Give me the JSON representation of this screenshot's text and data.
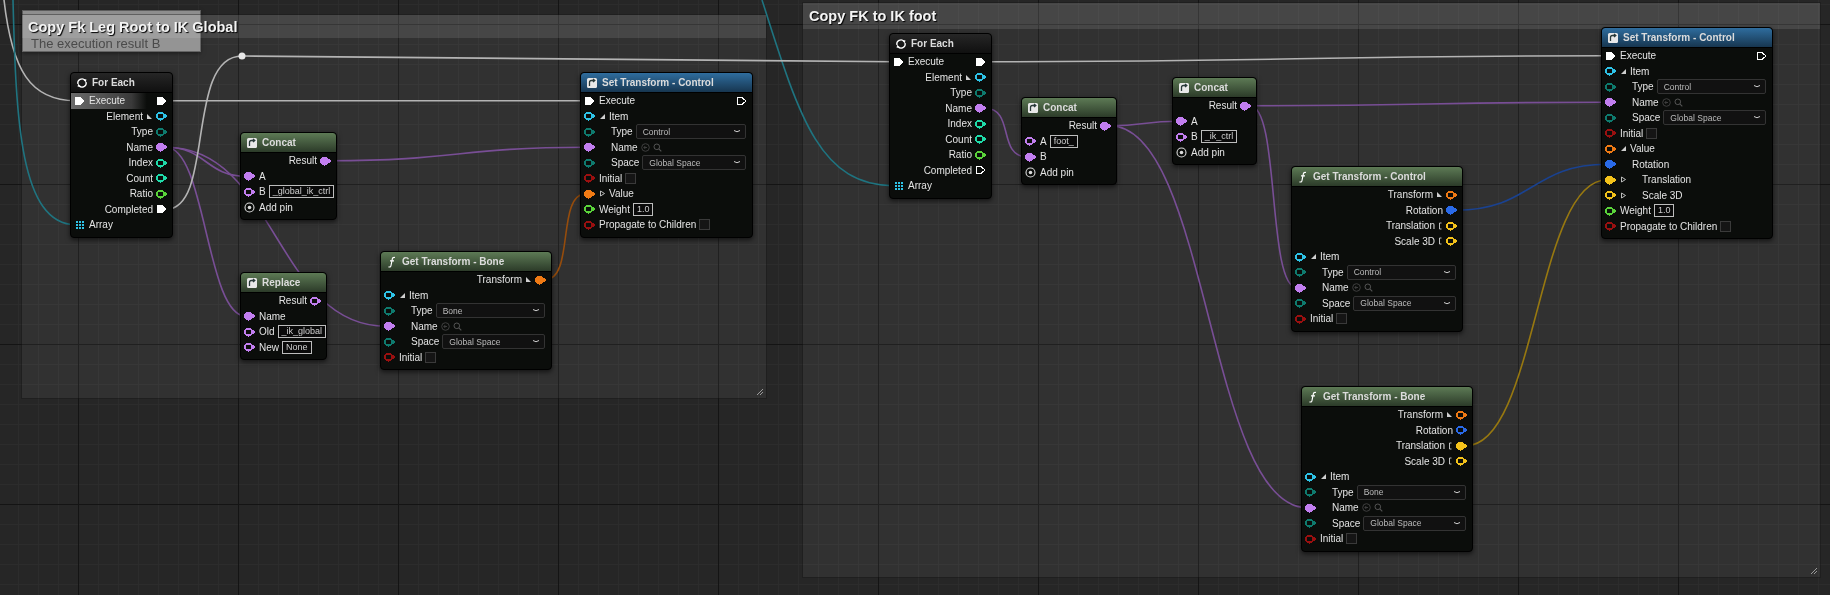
{
  "tooltip": {
    "text": "The execution result B"
  },
  "comments": [
    {
      "title": "Copy Fk Leg Root to IK Global",
      "nodes": [
        {
          "kind": "for_each",
          "title": "For Each",
          "rows": [
            {
              "label": "Execute",
              "hovered": true,
              "in": {
                "kind": "exec",
                "connected": true
              },
              "out": {
                "kind": "exec",
                "connected": true
              }
            },
            {
              "label": "Element",
              "split": true,
              "out": {
                "kind": "data",
                "color": "#2ec3e8",
                "connected": false
              }
            },
            {
              "label": "Type",
              "out": {
                "kind": "data",
                "color": "#0e7a6e",
                "connected": false
              }
            },
            {
              "label": "Name",
              "out": {
                "kind": "data",
                "color": "#c27ef0",
                "connected": true
              }
            },
            {
              "label": "Index",
              "out": {
                "kind": "data",
                "color": "#1fdcaa",
                "connected": false
              }
            },
            {
              "label": "Count",
              "out": {
                "kind": "data",
                "color": "#1fdcaa",
                "connected": false
              }
            },
            {
              "label": "Ratio",
              "out": {
                "kind": "data",
                "color": "#5ad43a",
                "connected": false
              }
            },
            {
              "label": "Completed",
              "out": {
                "kind": "exec",
                "connected": true
              }
            },
            {
              "label": "Array",
              "in": {
                "kind": "array",
                "connected": true
              }
            }
          ]
        },
        {
          "kind": "string_op",
          "title": "Concat",
          "rows": [
            {
              "label": "Result",
              "out": {
                "kind": "data",
                "color": "#c27ef0",
                "connected": true
              }
            },
            {
              "label": "A",
              "in": {
                "kind": "data",
                "color": "#c27ef0",
                "connected": true
              }
            },
            {
              "label": "B",
              "in": {
                "kind": "data",
                "color": "#c27ef0",
                "connected": false
              },
              "field": {
                "kind": "text",
                "value": "_global_ik_ctrl"
              }
            },
            {
              "label": "Add pin",
              "kind": "add_pin"
            }
          ]
        },
        {
          "kind": "string_op",
          "title": "Replace",
          "rows": [
            {
              "label": "Result",
              "out": {
                "kind": "data",
                "color": "#c27ef0",
                "connected": false
              }
            },
            {
              "label": "Name",
              "in": {
                "kind": "data",
                "color": "#c27ef0",
                "connected": true
              }
            },
            {
              "label": "Old",
              "in": {
                "kind": "data",
                "color": "#c27ef0",
                "connected": false
              },
              "field": {
                "kind": "text",
                "value": "_ik_global"
              }
            },
            {
              "label": "New",
              "in": {
                "kind": "data",
                "color": "#c27ef0",
                "connected": false
              },
              "field": {
                "kind": "text",
                "value": "None"
              }
            }
          ]
        },
        {
          "kind": "get",
          "title": "Get Transform - Bone",
          "rows": [
            {
              "label": "Transform",
              "split": true,
              "out": {
                "kind": "data",
                "color": "#f07a14",
                "connected": true
              }
            },
            {
              "label": "Item",
              "expanded": true,
              "in": {
                "kind": "data",
                "color": "#2ec3e8",
                "connected": false
              },
              "children": [
                {
                  "label": "Type",
                  "in": {
                    "kind": "data",
                    "color": "#0e7a6e",
                    "connected": false
                  },
                  "field": {
                    "kind": "dropdown",
                    "value": "Bone"
                  }
                },
                {
                  "label": "Name",
                  "in": {
                    "kind": "data",
                    "color": "#c27ef0",
                    "connected": true
                  },
                  "field": {
                    "kind": "picker"
                  }
                },
                {
                  "label": "Space",
                  "in": {
                    "kind": "data",
                    "color": "#0e7a6e",
                    "connected": false
                  },
                  "field": {
                    "kind": "dropdown",
                    "value": "Global Space"
                  }
                }
              ]
            },
            {
              "label": "Initial",
              "in": {
                "kind": "data",
                "color": "#9a1010",
                "connected": false
              },
              "field": {
                "kind": "checkbox",
                "checked": false
              }
            }
          ]
        },
        {
          "kind": "set",
          "title": "Set Transform - Control",
          "rows": [
            {
              "label": "Execute",
              "in": {
                "kind": "exec",
                "connected": true
              },
              "out": {
                "kind": "exec",
                "connected": false
              }
            },
            {
              "label": "Item",
              "expanded": true,
              "in": {
                "kind": "data",
                "color": "#2ec3e8",
                "connected": false
              },
              "children": [
                {
                  "label": "Type",
                  "in": {
                    "kind": "data",
                    "color": "#0e7a6e",
                    "connected": false
                  },
                  "field": {
                    "kind": "dropdown",
                    "value": "Control"
                  }
                },
                {
                  "label": "Name",
                  "in": {
                    "kind": "data",
                    "color": "#c27ef0",
                    "connected": true
                  },
                  "field": {
                    "kind": "picker"
                  }
                },
                {
                  "label": "Space",
                  "in": {
                    "kind": "data",
                    "color": "#0e7a6e",
                    "connected": false
                  },
                  "field": {
                    "kind": "dropdown",
                    "value": "Global Space"
                  }
                }
              ]
            },
            {
              "label": "Initial",
              "in": {
                "kind": "data",
                "color": "#9a1010",
                "connected": false
              },
              "field": {
                "kind": "checkbox",
                "checked": false
              }
            },
            {
              "label": "Value",
              "expanded": false,
              "in": {
                "kind": "data",
                "color": "#f07a14",
                "connected": true
              }
            },
            {
              "label": "Weight",
              "in": {
                "kind": "data",
                "color": "#5ad43a",
                "connected": false
              },
              "field": {
                "kind": "text",
                "value": "1.0"
              }
            },
            {
              "label": "Propagate to Children",
              "in": {
                "kind": "data",
                "color": "#9a1010",
                "connected": false
              },
              "field": {
                "kind": "checkbox",
                "checked": false
              }
            }
          ]
        }
      ]
    },
    {
      "title": "Copy FK to IK foot",
      "nodes": [
        {
          "kind": "for_each",
          "title": "For Each",
          "rows": [
            {
              "label": "Execute",
              "in": {
                "kind": "exec",
                "connected": true
              },
              "out": {
                "kind": "exec",
                "connected": true
              }
            },
            {
              "label": "Element",
              "split": true,
              "out": {
                "kind": "data",
                "color": "#2ec3e8",
                "connected": false
              }
            },
            {
              "label": "Type",
              "out": {
                "kind": "data",
                "color": "#0e7a6e",
                "connected": false
              }
            },
            {
              "label": "Name",
              "out": {
                "kind": "data",
                "color": "#c27ef0",
                "connected": true
              }
            },
            {
              "label": "Index",
              "out": {
                "kind": "data",
                "color": "#1fdcaa",
                "connected": false
              }
            },
            {
              "label": "Count",
              "out": {
                "kind": "data",
                "color": "#1fdcaa",
                "connected": false
              }
            },
            {
              "label": "Ratio",
              "out": {
                "kind": "data",
                "color": "#5ad43a",
                "connected": false
              }
            },
            {
              "label": "Completed",
              "out": {
                "kind": "exec",
                "connected": false
              }
            },
            {
              "label": "Array",
              "in": {
                "kind": "array",
                "connected": true
              }
            }
          ]
        },
        {
          "kind": "string_op",
          "title": "Concat",
          "rows": [
            {
              "label": "Result",
              "out": {
                "kind": "data",
                "color": "#c27ef0",
                "connected": true
              }
            },
            {
              "label": "A",
              "in": {
                "kind": "data",
                "color": "#c27ef0",
                "connected": false
              },
              "field": {
                "kind": "text",
                "value": "foot_"
              }
            },
            {
              "label": "B",
              "in": {
                "kind": "data",
                "color": "#c27ef0",
                "connected": true
              }
            },
            {
              "label": "Add pin",
              "kind": "add_pin"
            }
          ]
        },
        {
          "kind": "string_op",
          "title": "Concat",
          "rows": [
            {
              "label": "Result",
              "out": {
                "kind": "data",
                "color": "#c27ef0",
                "connected": true
              }
            },
            {
              "label": "A",
              "in": {
                "kind": "data",
                "color": "#c27ef0",
                "connected": true
              }
            },
            {
              "label": "B",
              "in": {
                "kind": "data",
                "color": "#c27ef0",
                "connected": false
              },
              "field": {
                "kind": "text",
                "value": "_ik_ctrl"
              }
            },
            {
              "label": "Add pin",
              "kind": "add_pin"
            }
          ]
        },
        {
          "kind": "get",
          "title": "Get Transform - Control",
          "rows": [
            {
              "label": "Transform",
              "split": true,
              "out": {
                "kind": "data",
                "color": "#f07a14",
                "connected": false
              }
            },
            {
              "label": "Rotation",
              "out": {
                "kind": "data",
                "color": "#2a6ae8",
                "connected": true
              }
            },
            {
              "label": "Translation",
              "sub": true,
              "out": {
                "kind": "data",
                "color": "#f4c21a",
                "connected": false
              }
            },
            {
              "label": "Scale 3D",
              "sub": true,
              "out": {
                "kind": "data",
                "color": "#f4c21a",
                "connected": false
              }
            },
            {
              "label": "Item",
              "expanded": true,
              "in": {
                "kind": "data",
                "color": "#2ec3e8",
                "connected": false
              },
              "children": [
                {
                  "label": "Type",
                  "in": {
                    "kind": "data",
                    "color": "#0e7a6e",
                    "connected": false
                  },
                  "field": {
                    "kind": "dropdown",
                    "value": "Control"
                  }
                },
                {
                  "label": "Name",
                  "in": {
                    "kind": "data",
                    "color": "#c27ef0",
                    "connected": true
                  },
                  "field": {
                    "kind": "picker"
                  }
                },
                {
                  "label": "Space",
                  "in": {
                    "kind": "data",
                    "color": "#0e7a6e",
                    "connected": false
                  },
                  "field": {
                    "kind": "dropdown",
                    "value": "Global Space"
                  }
                }
              ]
            },
            {
              "label": "Initial",
              "in": {
                "kind": "data",
                "color": "#9a1010",
                "connected": false
              },
              "field": {
                "kind": "checkbox",
                "checked": false
              }
            }
          ]
        },
        {
          "kind": "get",
          "title": "Get Transform - Bone",
          "rows": [
            {
              "label": "Transform",
              "split": true,
              "out": {
                "kind": "data",
                "color": "#f07a14",
                "connected": false
              }
            },
            {
              "label": "Rotation",
              "out": {
                "kind": "data",
                "color": "#2a6ae8",
                "connected": false
              }
            },
            {
              "label": "Translation",
              "sub": true,
              "out": {
                "kind": "data",
                "color": "#f4c21a",
                "connected": true
              }
            },
            {
              "label": "Scale 3D",
              "sub": true,
              "out": {
                "kind": "data",
                "color": "#f4c21a",
                "connected": false
              }
            },
            {
              "label": "Item",
              "expanded": true,
              "in": {
                "kind": "data",
                "color": "#2ec3e8",
                "connected": false
              },
              "children": [
                {
                  "label": "Type",
                  "in": {
                    "kind": "data",
                    "color": "#0e7a6e",
                    "connected": false
                  },
                  "field": {
                    "kind": "dropdown",
                    "value": "Bone"
                  }
                },
                {
                  "label": "Name",
                  "in": {
                    "kind": "data",
                    "color": "#c27ef0",
                    "connected": true
                  },
                  "field": {
                    "kind": "picker"
                  }
                },
                {
                  "label": "Space",
                  "in": {
                    "kind": "data",
                    "color": "#0e7a6e",
                    "connected": false
                  },
                  "field": {
                    "kind": "dropdown",
                    "value": "Global Space"
                  }
                }
              ]
            },
            {
              "label": "Initial",
              "in": {
                "kind": "data",
                "color": "#9a1010",
                "connected": false
              },
              "field": {
                "kind": "checkbox",
                "checked": false
              }
            }
          ]
        },
        {
          "kind": "set",
          "title": "Set Transform - Control",
          "rows": [
            {
              "label": "Execute",
              "in": {
                "kind": "exec",
                "connected": true
              },
              "out": {
                "kind": "exec",
                "connected": false
              }
            },
            {
              "label": "Item",
              "expanded": true,
              "in": {
                "kind": "data",
                "color": "#2ec3e8",
                "connected": false
              },
              "children": [
                {
                  "label": "Type",
                  "in": {
                    "kind": "data",
                    "color": "#0e7a6e",
                    "connected": false
                  },
                  "field": {
                    "kind": "dropdown",
                    "value": "Control"
                  }
                },
                {
                  "label": "Name",
                  "in": {
                    "kind": "data",
                    "color": "#c27ef0",
                    "connected": true
                  },
                  "field": {
                    "kind": "picker"
                  }
                },
                {
                  "label": "Space",
                  "in": {
                    "kind": "data",
                    "color": "#0e7a6e",
                    "connected": false
                  },
                  "field": {
                    "kind": "dropdown",
                    "value": "Global Space"
                  }
                }
              ]
            },
            {
              "label": "Initial",
              "in": {
                "kind": "data",
                "color": "#9a1010",
                "connected": false
              },
              "field": {
                "kind": "checkbox",
                "checked": false
              }
            },
            {
              "label": "Value",
              "expanded": true,
              "in": {
                "kind": "data",
                "color": "#f07a14",
                "connected": false
              },
              "children": [
                {
                  "label": "Rotation",
                  "in": {
                    "kind": "data",
                    "color": "#2a6ae8",
                    "connected": true
                  }
                },
                {
                  "label": "Translation",
                  "expanded": false,
                  "in": {
                    "kind": "data",
                    "color": "#f4c21a",
                    "connected": true
                  }
                },
                {
                  "label": "Scale 3D",
                  "expanded": false,
                  "in": {
                    "kind": "data",
                    "color": "#f4c21a",
                    "connected": false
                  }
                }
              ]
            },
            {
              "label": "Weight",
              "in": {
                "kind": "data",
                "color": "#5ad43a",
                "connected": false
              },
              "field": {
                "kind": "text",
                "value": "1.0"
              }
            },
            {
              "label": "Propagate to Children",
              "in": {
                "kind": "data",
                "color": "#9a1010",
                "connected": false
              },
              "field": {
                "kind": "checkbox",
                "checked": false
              }
            }
          ]
        }
      ]
    }
  ]
}
